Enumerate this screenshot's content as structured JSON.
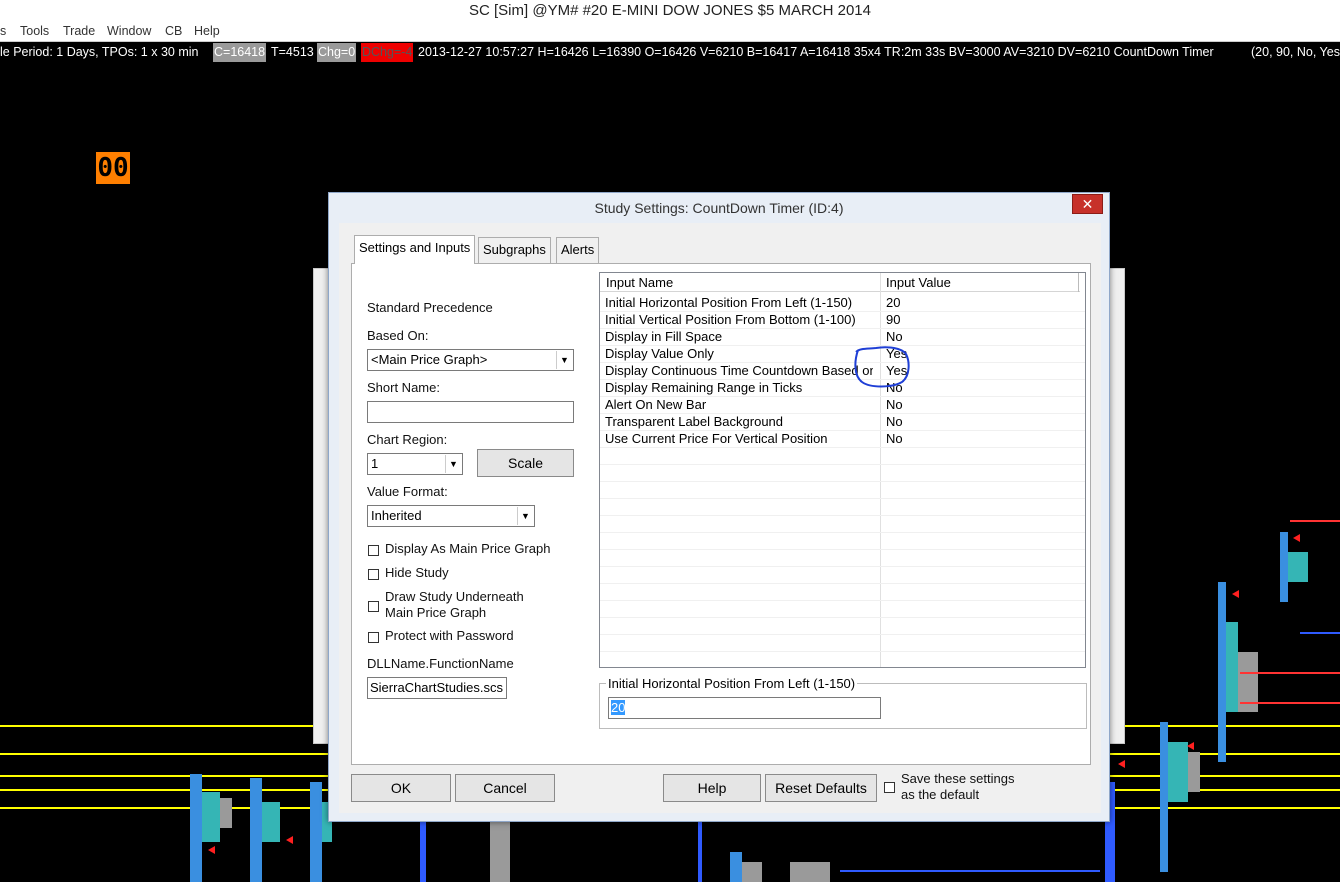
{
  "window": {
    "title": "SC [Sim] @YM#  #20  E-MINI DOW JONES $5 MARCH 2014"
  },
  "menu": {
    "items": [
      "s",
      "Tools",
      "Trade",
      "Window",
      "CB",
      "Help"
    ]
  },
  "info_bar": {
    "period": "le Period: 1 Days, TPOs: 1 x 30 min",
    "close": "C=16418",
    "ticks": "T=4513",
    "chg": "Chg=0",
    "dchg": "DChg=-4",
    "rest": "2013-12-27 10:57:27 H=16426 L=16390 O=16426 V=6210 B=16417 A=16418 35x4 TR:2m 33s BV=3000 AV=3210 DV=6210 CountDown Timer",
    "params": "(20, 90, No, Yes"
  },
  "timer_value": "00",
  "dialog": {
    "title": "Study Settings: CountDown Timer (ID:4)",
    "close_glyph": "✕",
    "tabs": [
      "Settings and Inputs",
      "Subgraphs",
      "Alerts"
    ],
    "left": {
      "standard_precedence": "Standard Precedence",
      "based_on_label": "Based On:",
      "based_on_value": "<Main Price Graph>",
      "short_name_label": "Short Name:",
      "short_name_value": "",
      "chart_region_label": "Chart Region:",
      "chart_region_value": "1",
      "scale_button": "Scale",
      "value_format_label": "Value Format:",
      "value_format_value": "Inherited",
      "checkboxes": [
        "Display As Main Price Graph",
        "Hide Study",
        "Draw Study Underneath",
        "Main Price Graph",
        "Protect with Password"
      ],
      "dll_label": "DLLName.FunctionName",
      "dll_value": "SierraChartStudies.scs"
    },
    "grid": {
      "col_name": "Input Name",
      "col_value": "Input Value",
      "rows": [
        {
          "name": "Initial Horizontal Position From Left (1-150)",
          "value": "20"
        },
        {
          "name": "Initial Vertical Position From Bottom (1-100)",
          "value": "90"
        },
        {
          "name": "Display in Fill Space",
          "value": "No"
        },
        {
          "name": "Display Value Only",
          "value": "Yes"
        },
        {
          "name": "Display Continuous Time Countdown Based on Real-Time Clock",
          "value": "Yes"
        },
        {
          "name": "Display Remaining Range in Ticks",
          "value": "No"
        },
        {
          "name": "Alert On New Bar",
          "value": "No"
        },
        {
          "name": "Transparent Label Background",
          "value": "No"
        },
        {
          "name": "Use Current Price For Vertical Position",
          "value": "No"
        }
      ]
    },
    "edit": {
      "label": "Initial Horizontal Position From Left (1-150)",
      "value": "20"
    },
    "buttons": {
      "ok": "OK",
      "cancel": "Cancel",
      "help": "Help",
      "reset": "Reset Defaults",
      "save_default_1": "Save these settings",
      "save_default_2": "as the default"
    }
  },
  "colors": {
    "accent_orange": "#ff7f00",
    "close_red": "#c7312a",
    "annot_blue": "#1f3fd6"
  }
}
